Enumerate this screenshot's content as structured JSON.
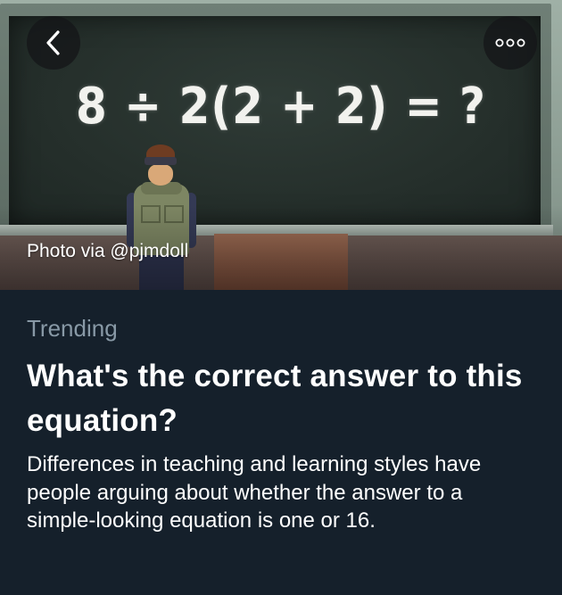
{
  "hero": {
    "equation_text": "8 ÷ 2(2 + 2) = ?",
    "photo_credit": "Photo via @pjmdoll",
    "back_icon": "chevron-left-icon",
    "more_icon": "more-horizontal-icon"
  },
  "story": {
    "category": "Trending",
    "headline": "What's the correct answer to this equation?",
    "summary": "Differences in teaching and learning styles have people arguing about whether the answer to a simple-looking equation is one or 16."
  },
  "colors": {
    "background": "#15202b",
    "secondary_text": "#8899a6",
    "primary_text": "#ffffff"
  }
}
